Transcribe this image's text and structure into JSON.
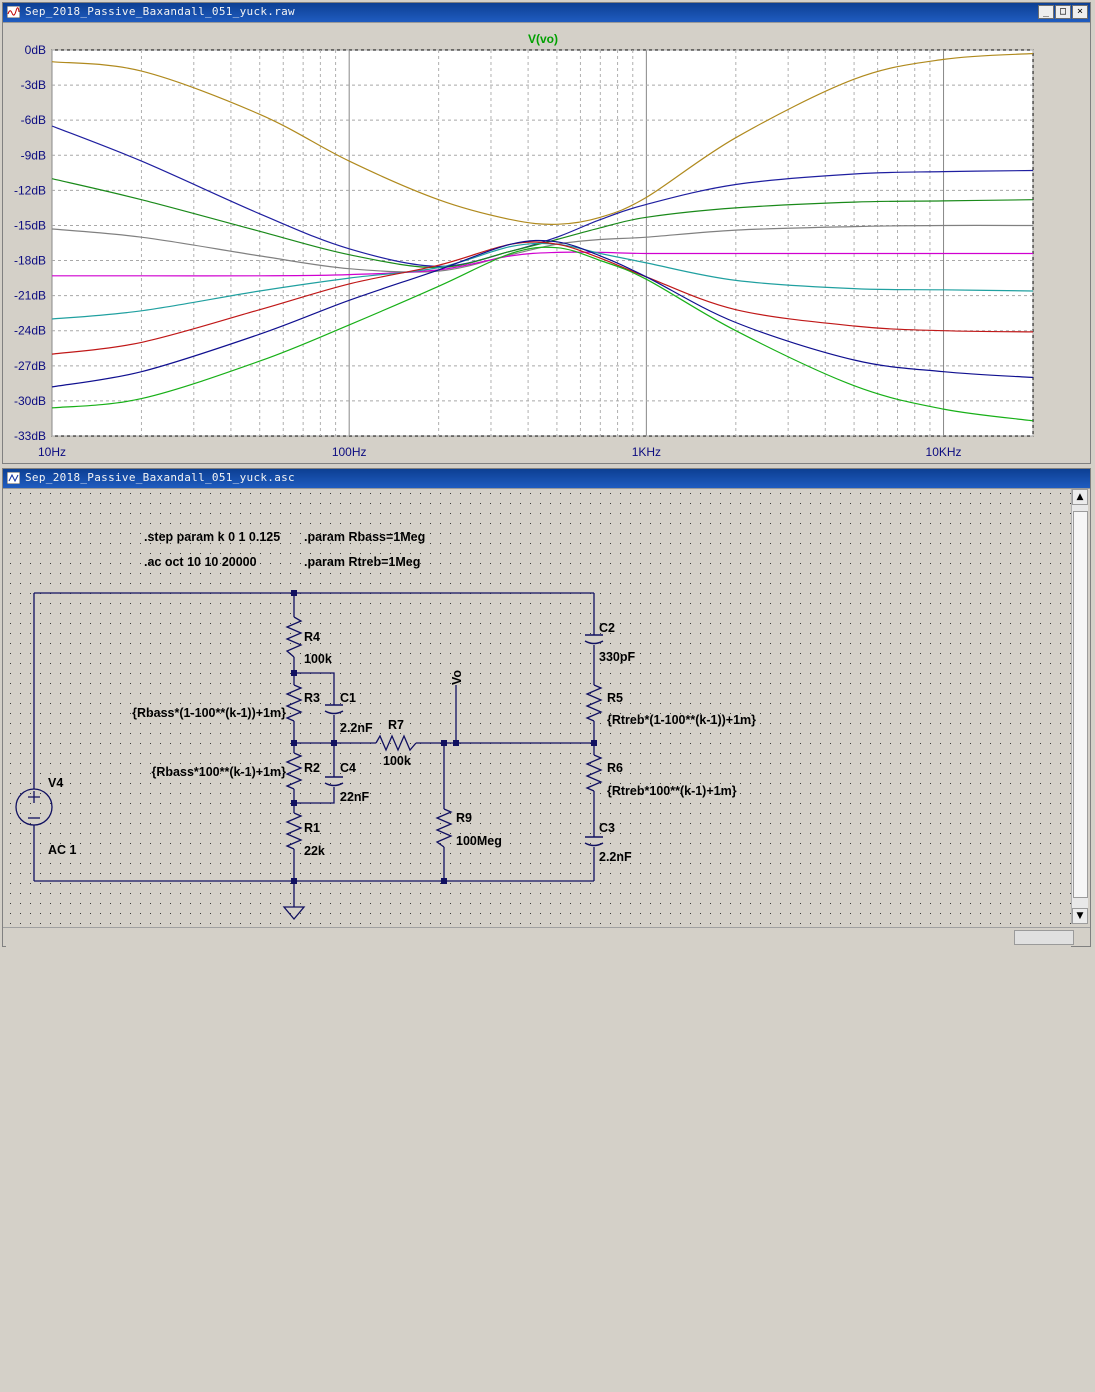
{
  "plot_window": {
    "title": "Sep_2018_Passive_Baxandall_051_yuck.raw",
    "trace_label": "V(vo)",
    "trace_label_color": "#00a000"
  },
  "schematic_window": {
    "title": "Sep_2018_Passive_Baxandall_051_yuck.asc",
    "directives": [
      ".step param k 0 1 0.125",
      ".param Rbass=1Meg",
      ".ac oct 10 10 20000",
      ".param Rtreb=1Meg"
    ],
    "components": {
      "R4": {
        "name": "R4",
        "value": "100k"
      },
      "R3": {
        "name": "R3",
        "value": "{Rbass*(1-100**(k-1))+1m}"
      },
      "C1": {
        "name": "C1",
        "value": "2.2nF"
      },
      "R2": {
        "name": "R2",
        "value": "{Rbass*100**(k-1)+1m}"
      },
      "C4": {
        "name": "C4",
        "value": "22nF"
      },
      "R1": {
        "name": "R1",
        "value": "22k"
      },
      "R7": {
        "name": "R7",
        "value": "100k"
      },
      "R9": {
        "name": "R9",
        "value": "100Meg"
      },
      "C2": {
        "name": "C2",
        "value": "330pF"
      },
      "R5": {
        "name": "R5",
        "value": "{Rtreb*(1-100**(k-1))+1m}"
      },
      "R6": {
        "name": "R6",
        "value": "{Rtreb*100**(k-1)+1m}"
      },
      "C3": {
        "name": "C3",
        "value": "2.2nF"
      },
      "V4": {
        "name": "V4",
        "value": "AC 1"
      }
    },
    "net_label": "Vo"
  },
  "chart_data": {
    "type": "line",
    "title": "V(vo)",
    "xlabel": "",
    "ylabel": "",
    "xscale": "log",
    "xlim": [
      10,
      20000
    ],
    "ylim": [
      -33,
      0
    ],
    "grid": true,
    "y_ticks": [
      "0dB",
      "-3dB",
      "-6dB",
      "-9dB",
      "-12dB",
      "-15dB",
      "-18dB",
      "-21dB",
      "-24dB",
      "-27dB",
      "-30dB",
      "-33dB"
    ],
    "x_ticks": [
      "10Hz",
      "100Hz",
      "1KHz",
      "10KHz"
    ],
    "x": [
      10,
      20,
      50,
      100,
      200,
      350,
      500,
      700,
      1000,
      2000,
      5000,
      10000,
      20000
    ],
    "series": [
      {
        "color": "#b08a1e",
        "values": [
          -1.0,
          -1.8,
          -5.5,
          -9.5,
          -12.8,
          -14.5,
          -14.9,
          -14.3,
          -12.6,
          -7.5,
          -2.5,
          -0.8,
          -0.3
        ]
      },
      {
        "color": "#1f1fa0",
        "values": [
          -6.5,
          -9.5,
          -14.0,
          -17.0,
          -18.5,
          -17.2,
          -16.0,
          -14.5,
          -13.2,
          -11.5,
          -10.6,
          -10.4,
          -10.3
        ]
      },
      {
        "color": "#1a8a1a",
        "values": [
          -11.0,
          -12.8,
          -15.5,
          -17.5,
          -18.6,
          -17.2,
          -16.2,
          -15.2,
          -14.3,
          -13.5,
          -13.0,
          -12.9,
          -12.8
        ]
      },
      {
        "color": "#808080",
        "values": [
          -15.3,
          -16.0,
          -17.6,
          -18.7,
          -18.9,
          -17.5,
          -16.6,
          -16.2,
          -16.0,
          -15.4,
          -15.1,
          -15.0,
          -15.0
        ]
      },
      {
        "color": "#d000d0",
        "values": [
          -19.3,
          -19.3,
          -19.3,
          -19.2,
          -18.8,
          -17.6,
          -17.3,
          -17.3,
          -17.4,
          -17.4,
          -17.4,
          -17.4,
          -17.4
        ]
      },
      {
        "color": "#20a0a0",
        "values": [
          -23.0,
          -22.3,
          -20.6,
          -19.5,
          -18.6,
          -16.8,
          -16.6,
          -17.4,
          -18.2,
          -19.7,
          -20.4,
          -20.5,
          -20.6
        ]
      },
      {
        "color": "#c01818",
        "values": [
          -26.0,
          -25.0,
          -22.2,
          -20.0,
          -18.4,
          -16.6,
          -16.6,
          -17.8,
          -19.4,
          -22.2,
          -23.6,
          -24.0,
          -24.1
        ]
      },
      {
        "color": "#101090",
        "values": [
          -28.8,
          -27.5,
          -24.3,
          -21.4,
          -18.8,
          -16.6,
          -16.4,
          -17.6,
          -19.4,
          -23.3,
          -26.5,
          -27.5,
          -28.0
        ]
      },
      {
        "color": "#18b018",
        "values": [
          -30.6,
          -29.8,
          -26.6,
          -23.5,
          -20.2,
          -17.4,
          -16.9,
          -18.0,
          -19.6,
          -24.0,
          -28.7,
          -30.7,
          -31.7
        ]
      }
    ]
  }
}
